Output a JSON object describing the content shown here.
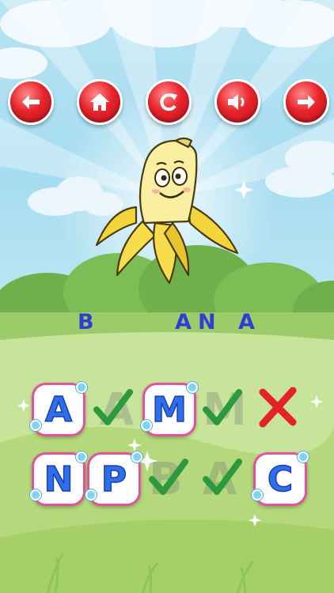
{
  "toolbar": {
    "buttons": [
      {
        "name": "back-button",
        "icon": "arrow-left-icon"
      },
      {
        "name": "home-button",
        "icon": "home-icon"
      },
      {
        "name": "restart-button",
        "icon": "refresh-icon"
      },
      {
        "name": "sound-button",
        "icon": "speaker-icon"
      },
      {
        "name": "next-button",
        "icon": "arrow-right-icon"
      }
    ]
  },
  "picture": {
    "subject": "banana"
  },
  "word": {
    "letters": [
      "B",
      "A",
      "N",
      "A"
    ],
    "letters_shown": [
      "B",
      "",
      "A",
      "N",
      "A"
    ]
  },
  "tiles": {
    "row1": {
      "first": "A",
      "second": "M"
    },
    "row2": {
      "first": "N",
      "second": "P",
      "third": "C"
    }
  },
  "ghost_letters": {
    "row1": [
      "A",
      "M"
    ],
    "row2": [
      "B",
      "A"
    ]
  },
  "marks": {
    "row1": [
      "check",
      "check",
      "cross"
    ],
    "row2": [
      "check",
      "check"
    ]
  },
  "colors": {
    "button_red": "#e8242c",
    "letter_blue": "#2f3fcf",
    "tile_letter": "#2e6ee8",
    "check_green": "#2b9a3c",
    "cross_red": "#e3222a",
    "tile_border": "#e0559a"
  }
}
